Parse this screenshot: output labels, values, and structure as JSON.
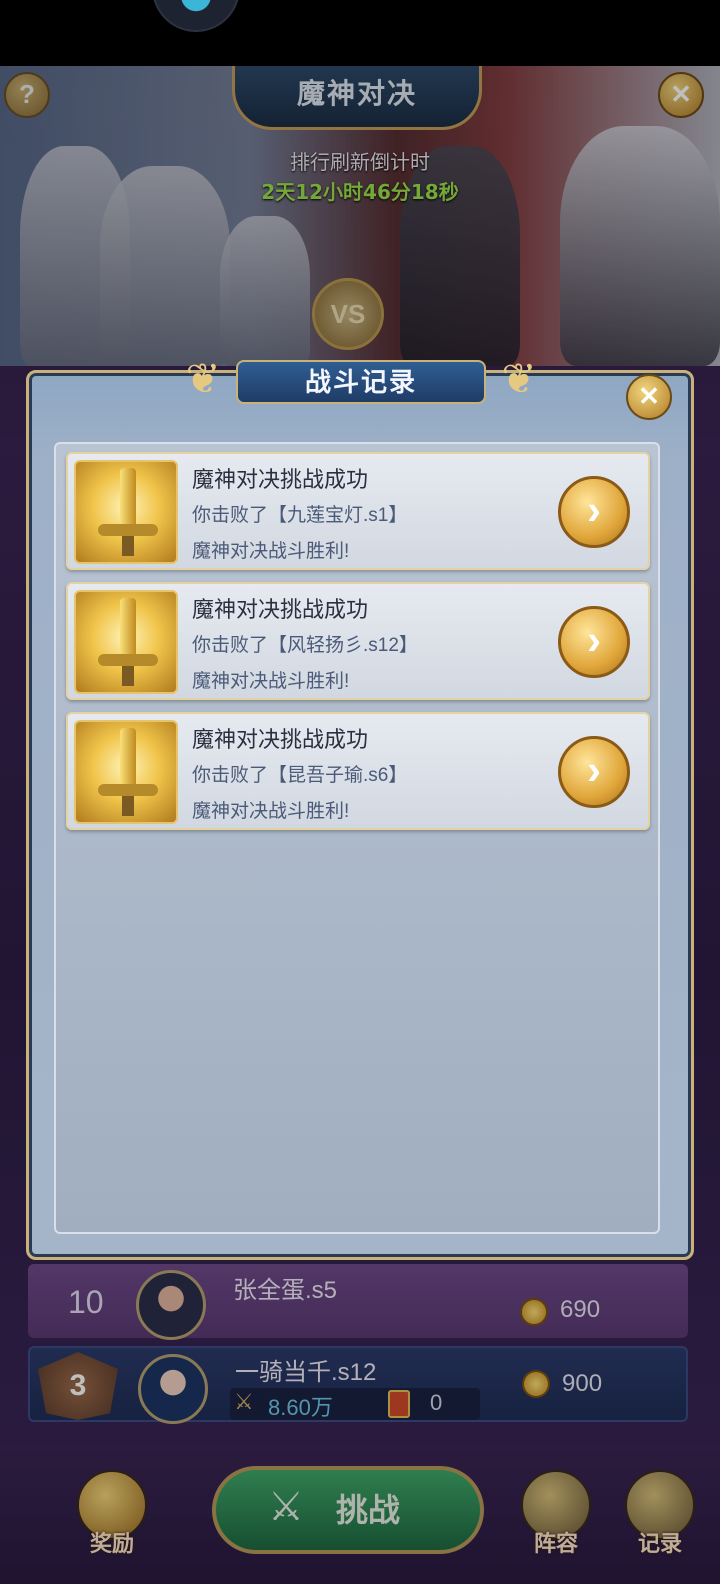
{
  "screen": {
    "title": "魔神对决",
    "countdown_label": "排行刷新倒计时",
    "countdown_value": "2天12小时46分18秒",
    "help_icon": "?",
    "close_icon": "✕",
    "vs_text": "VS"
  },
  "modal": {
    "title": "战斗记录",
    "close_icon": "✕",
    "records": [
      {
        "title": "魔神对决挑战成功",
        "detail": "你击败了【九莲宝灯.s1】",
        "result": "魔神对决战斗胜利!"
      },
      {
        "title": "魔神对决挑战成功",
        "detail": "你击败了【风轻扬彡.s12】",
        "result": "魔神对决战斗胜利!"
      },
      {
        "title": "魔神对决挑战成功",
        "detail": "你击败了【昆吾子瑜.s6】",
        "result": "魔神对决战斗胜利!"
      }
    ],
    "arrow_icon": "›"
  },
  "ranking": {
    "row10": {
      "rank": "10",
      "name": "张全蛋.s5",
      "score": "690"
    },
    "self": {
      "rank": "3",
      "name": "一骑当千.s12",
      "power": "8.60万",
      "tickets": "0",
      "score": "900"
    }
  },
  "bottom_nav": {
    "reward": "奖励",
    "challenge": "挑战",
    "lineup": "阵容",
    "record": "记录"
  },
  "colors": {
    "countdown": "#9be04b",
    "accent_gold": "#c9a650",
    "challenge_green": "#3fa86a"
  }
}
